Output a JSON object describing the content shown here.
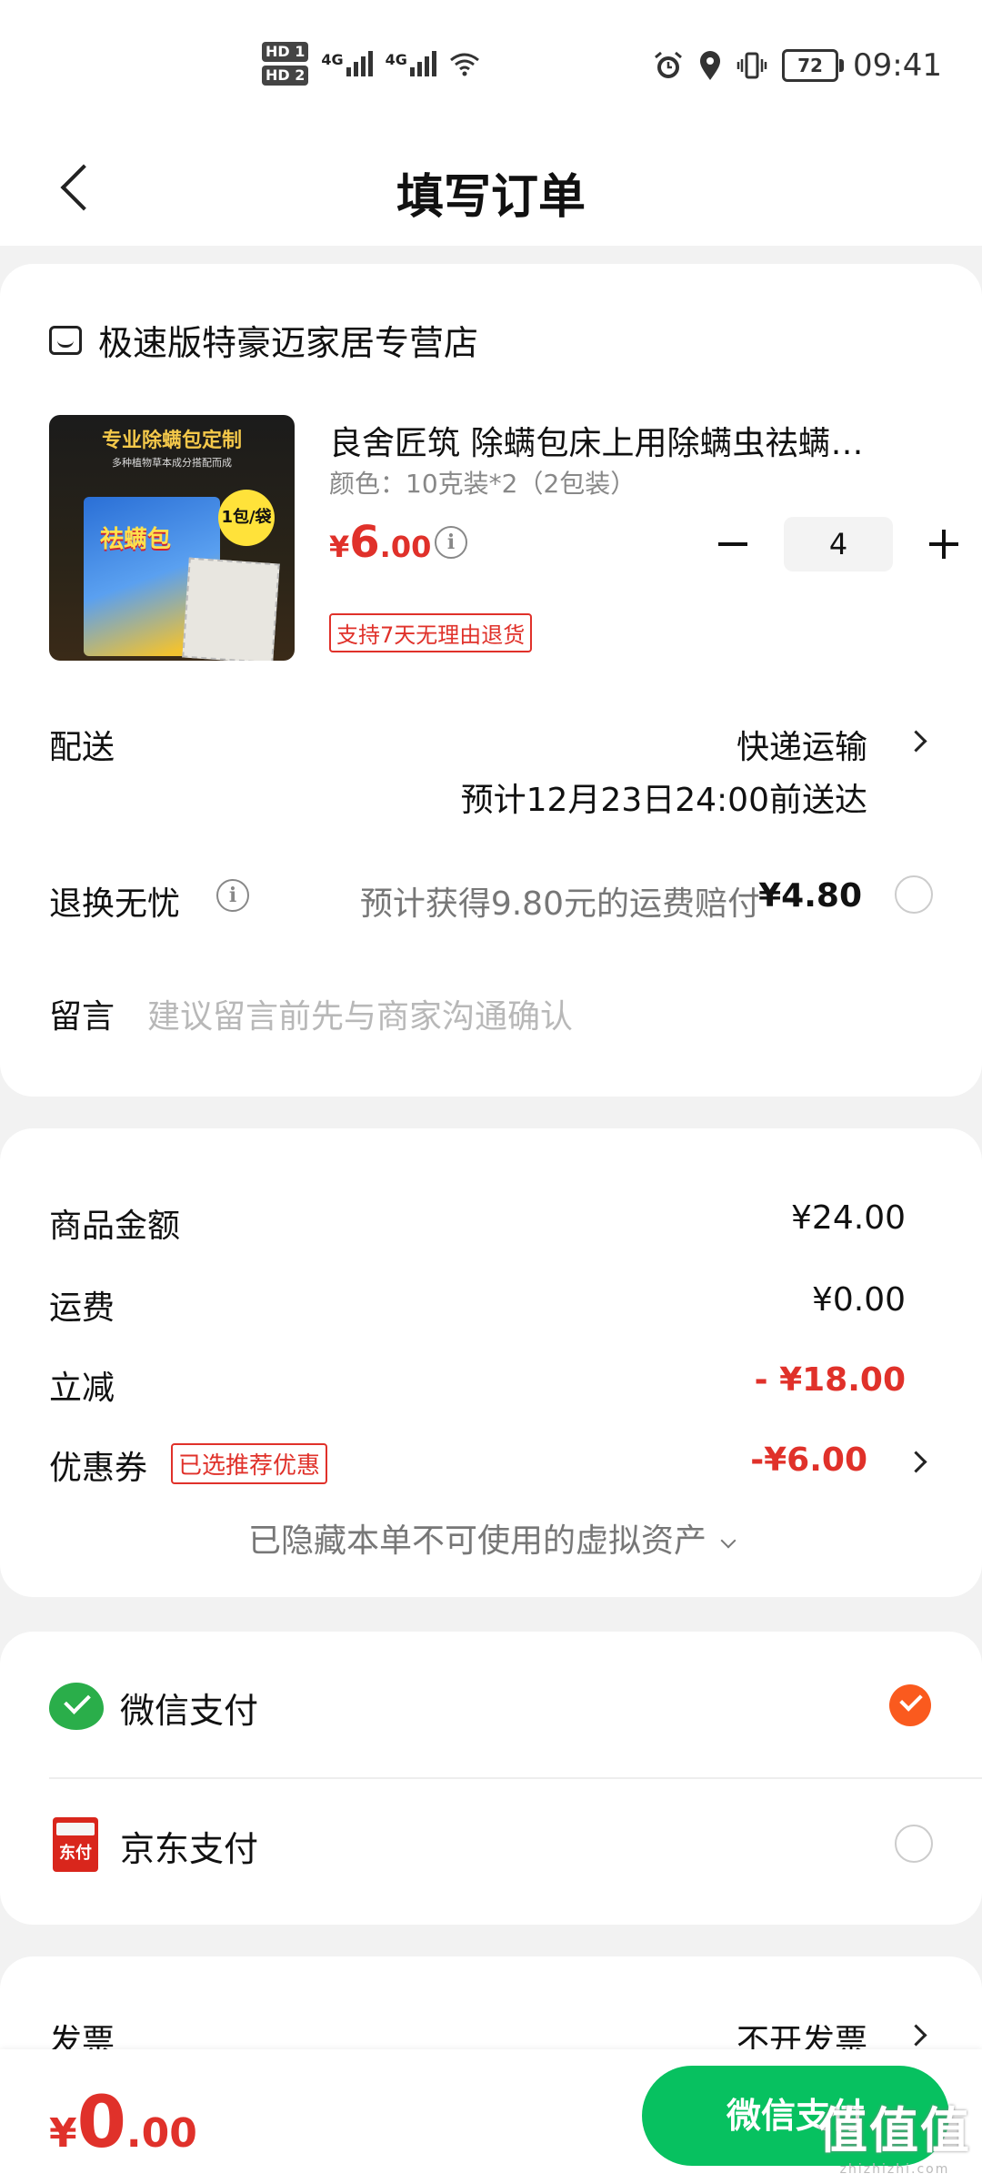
{
  "status_bar": {
    "time": "09:41",
    "battery": "72",
    "sim1": "HD 1",
    "sim2": "HD 2",
    "net": "4G"
  },
  "header": {
    "title": "填写订单"
  },
  "store": {
    "name": "极速版特豪迈家居专营店"
  },
  "product": {
    "image_title": "专业除螨包定制",
    "image_subtitle": "多种植物草本成分搭配而成",
    "image_pkg_name": "祛螨包",
    "image_badge": "1包/袋",
    "name": "良舍匠筑 除螨包床上用除螨虫祛螨…",
    "spec": "颜色：10克装*2（2包装）",
    "price_currency": "¥",
    "price_int": "6",
    "price_dec": ".00",
    "quantity": "4",
    "return_tag": "支持7天无理由退货"
  },
  "shipping": {
    "label": "配送",
    "method": "快递运输",
    "eta": "预计12月23日24:00前送达"
  },
  "return_insurance": {
    "label": "退换无忧",
    "desc": "预计获得9.80元的运费赔付",
    "price": "¥4.80"
  },
  "message": {
    "label": "留言",
    "placeholder": "建议留言前先与商家沟通确认"
  },
  "summary": {
    "goods_label": "商品金额",
    "goods_value": "¥24.00",
    "shipping_label": "运费",
    "shipping_value": "¥0.00",
    "discount_label": "立减",
    "discount_value": "- ¥18.00",
    "coupon_label": "优惠券",
    "coupon_tag": "已选推荐优惠",
    "coupon_value": "-¥6.00",
    "hidden_assets": "已隐藏本单不可使用的虚拟资产"
  },
  "payment": {
    "options": [
      {
        "name": "微信支付",
        "selected": true
      },
      {
        "name": "京东支付",
        "icon_text": "东付",
        "selected": false
      }
    ]
  },
  "invoice": {
    "label": "发票",
    "value": "不开发票"
  },
  "bottom": {
    "total_currency": "¥",
    "total_int": "0",
    "total_dec": ".00",
    "pay_button": "微信支付"
  },
  "watermark": {
    "text": "值值值",
    "sub": "zhizhizhi.com"
  },
  "colors": {
    "accent_red": "#e0312a",
    "wechat_green": "#07c160",
    "check_orange": "#fa5a1e"
  }
}
